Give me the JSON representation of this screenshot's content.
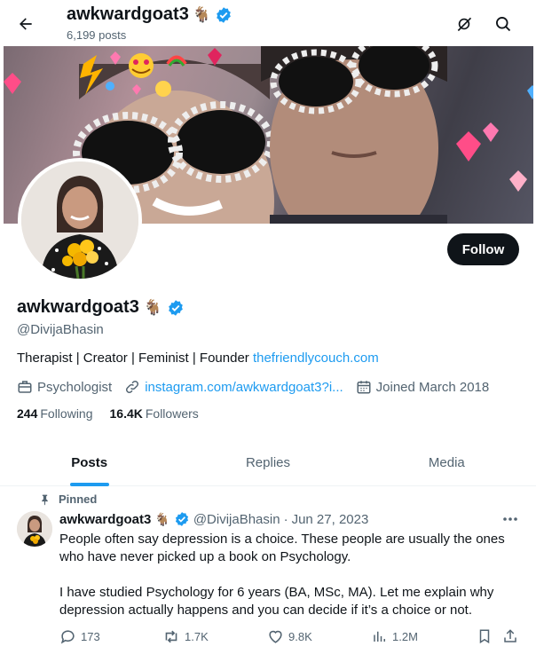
{
  "header": {
    "display_name": "awkwardgoat3",
    "name_emoji": "🐐",
    "posts_count": "6,199 posts",
    "back_icon": "arrow-left-icon",
    "grok_icon": "grok-icon",
    "search_icon": "search-icon"
  },
  "profile": {
    "display_name": "awkwardgoat3",
    "name_emoji": "🐐",
    "handle": "@DivijaBhasin",
    "bio_text": "Therapist | Creator | Feminist | Founder ",
    "bio_link": "thefriendlycouch.com",
    "category": "Psychologist",
    "website": "instagram.com/awkwardgoat3?i...",
    "joined": "Joined March 2018",
    "following_count": "244",
    "following_label": "Following",
    "followers_count": "16.4K",
    "followers_label": "Followers",
    "follow_button": "Follow"
  },
  "tabs": [
    {
      "label": "Posts",
      "active": true
    },
    {
      "label": "Replies",
      "active": false
    },
    {
      "label": "Media",
      "active": false
    }
  ],
  "post": {
    "pinned_label": "Pinned",
    "author_name": "awkwardgoat3",
    "author_emoji": "🐐",
    "author_handle": "@DivijaBhasin",
    "separator": "·",
    "date": "Jun 27, 2023",
    "text_1": "People often say depression is a choice. These people are usually the ones who have never picked up a book on Psychology.",
    "text_2": "I have studied Psychology for 6 years (BA, MSc, MA). Let me explain why depression actually happens and you can decide if it’s a choice or not.",
    "replies": "173",
    "reposts": "1.7K",
    "likes": "9.8K",
    "views": "1.2M"
  },
  "colors": {
    "accent": "#1d9bf0",
    "text": "#0f1419",
    "muted": "#536471",
    "verified": "#1d9bf0"
  }
}
